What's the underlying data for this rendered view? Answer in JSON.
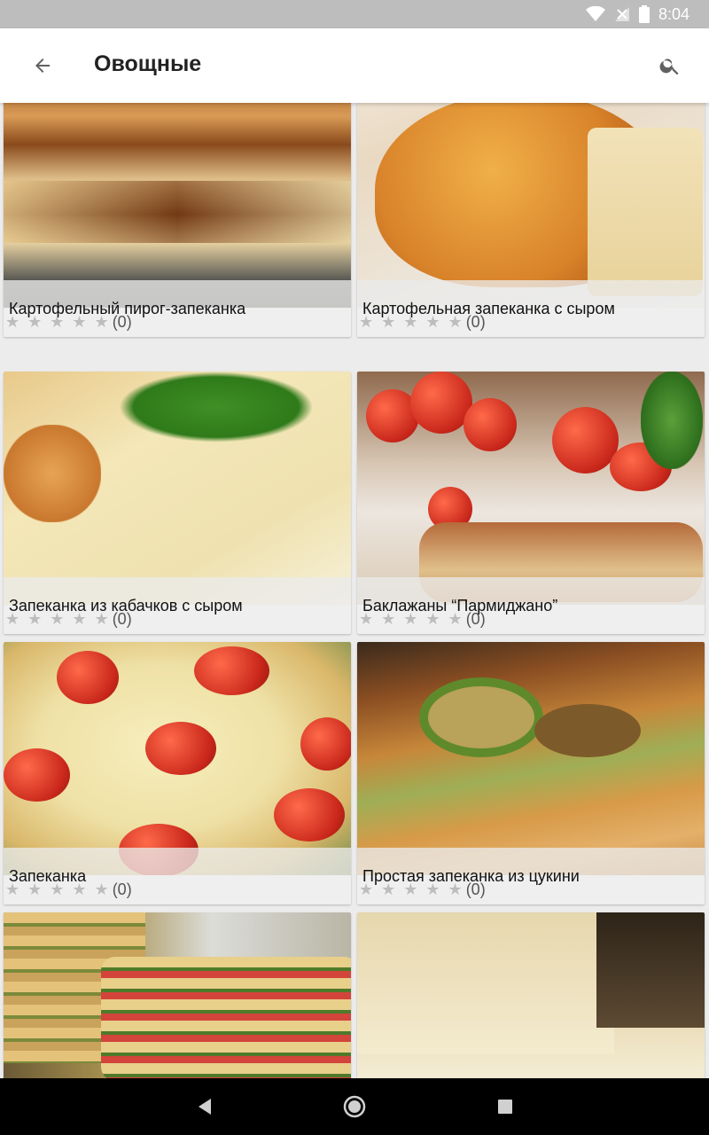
{
  "status": {
    "time": "8:04"
  },
  "appbar": {
    "title": "Овощные"
  },
  "recipes": [
    {
      "title": "Картофельный пирог-запеканка",
      "rating_count": "(0)",
      "stars": 0
    },
    {
      "title": "Картофельная запеканка с сыром",
      "rating_count": "(0)",
      "stars": 0
    },
    {
      "title": "Запеканка из кабачков с сыром",
      "rating_count": "(0)",
      "stars": 0
    },
    {
      "title": "Баклажаны “Пармиджано”",
      "rating_count": "(0)",
      "stars": 0
    },
    {
      "title": "Запеканка",
      "rating_count": "(0)",
      "stars": 0
    },
    {
      "title": "Простая запеканка из цукини",
      "rating_count": "(0)",
      "stars": 0
    }
  ],
  "star_glyphs": "★ ★ ★ ★ ★",
  "colors": {
    "statusbar": "#bdbdbd",
    "appbar": "#ffffff",
    "caption_bg": "#ebebeb",
    "star_empty": "#bdbdbd"
  }
}
